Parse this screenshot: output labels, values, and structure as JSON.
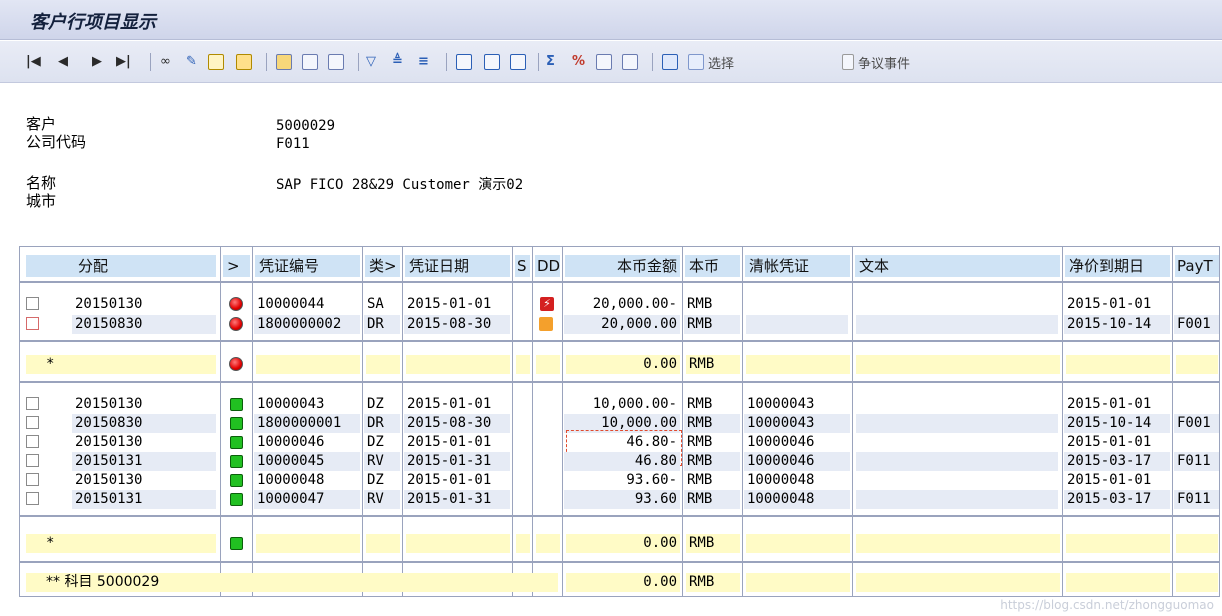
{
  "window": {
    "title": "客户行项目显示"
  },
  "toolbar": {
    "select_label": "选择",
    "dispute_label": "争议事件",
    "icons": [
      "first-page-icon",
      "prev-page-icon",
      "next-page-icon",
      "last-page-icon",
      "glasses-icon",
      "pencil-icon",
      "grid-icon",
      "doc-icon",
      "exchange-icon",
      "copy-icon",
      "find-icon",
      "filter-icon",
      "sort-asc-icon",
      "sort-desc-icon",
      "layout-icon",
      "layout2-icon",
      "layout3-icon",
      "sum-icon",
      "subtotal-icon",
      "export-icon",
      "print-icon",
      "info-icon",
      "info2-icon",
      "page-icon"
    ]
  },
  "header": {
    "customer_label": "客户",
    "customer_value": "5000029",
    "company_label": "公司代码",
    "company_value": "F011",
    "name_label": "名称",
    "name_value": "SAP FICO 28&29 Customer 演示02",
    "city_label": "城市",
    "city_value": ""
  },
  "columns": {
    "assignment": "分配",
    "status": ">",
    "doc_no": "凭证编号",
    "type": "类>",
    "doc_date": "凭证日期",
    "s": "S",
    "dd": "DD",
    "amount": "本币金额",
    "currency": "本币",
    "clearing": "清帐凭证",
    "text": "文本",
    "due_date": "净价到期日",
    "payt": "PayT"
  },
  "group1": {
    "rows": [
      {
        "assignment": "20150130",
        "doc_no": "10000044",
        "type": "SA",
        "doc_date": "2015-01-01",
        "amount": "20,000.00-",
        "currency": "RMB",
        "clearing": "",
        "text": "",
        "due_date": "2015-01-01",
        "payt": "",
        "status": "red",
        "dd": "lightning"
      },
      {
        "assignment": "20150830",
        "doc_no": "1800000002",
        "type": "DR",
        "doc_date": "2015-08-30",
        "amount": "20,000.00",
        "currency": "RMB",
        "clearing": "",
        "text": "",
        "due_date": "2015-10-14",
        "payt": "F001",
        "status": "red",
        "dd": "overdue"
      }
    ],
    "subtotal": {
      "marker": "*",
      "amount": "0.00",
      "currency": "RMB"
    }
  },
  "group2": {
    "rows": [
      {
        "assignment": "20150130",
        "doc_no": "10000043",
        "type": "DZ",
        "doc_date": "2015-01-01",
        "amount": "10,000.00-",
        "currency": "RMB",
        "clearing": "10000043",
        "text": "",
        "due_date": "2015-01-01",
        "payt": ""
      },
      {
        "assignment": "20150830",
        "doc_no": "1800000001",
        "type": "DR",
        "doc_date": "2015-08-30",
        "amount": "10,000.00",
        "currency": "RMB",
        "clearing": "10000043",
        "text": "",
        "due_date": "2015-10-14",
        "payt": "F001"
      },
      {
        "assignment": "20150130",
        "doc_no": "10000046",
        "type": "DZ",
        "doc_date": "2015-01-01",
        "amount": "46.80-",
        "currency": "RMB",
        "clearing": "10000046",
        "text": "",
        "due_date": "2015-01-01",
        "payt": ""
      },
      {
        "assignment": "20150131",
        "doc_no": "10000045",
        "type": "RV",
        "doc_date": "2015-01-31",
        "amount": "46.80",
        "currency": "RMB",
        "clearing": "10000046",
        "text": "",
        "due_date": "2015-03-17",
        "payt": "F011"
      },
      {
        "assignment": "20150130",
        "doc_no": "10000048",
        "type": "DZ",
        "doc_date": "2015-01-01",
        "amount": "93.60-",
        "currency": "RMB",
        "clearing": "10000048",
        "text": "",
        "due_date": "2015-01-01",
        "payt": ""
      },
      {
        "assignment": "20150131",
        "doc_no": "10000047",
        "type": "RV",
        "doc_date": "2015-01-31",
        "amount": "93.60",
        "currency": "RMB",
        "clearing": "10000048",
        "text": "",
        "due_date": "2015-03-17",
        "payt": "F011"
      }
    ],
    "subtotal": {
      "marker": "*",
      "amount": "0.00",
      "currency": "RMB"
    }
  },
  "total": {
    "label": "** 科目 5000029",
    "amount": "0.00",
    "currency": "RMB"
  },
  "colors": {
    "status_red": "#e10000",
    "status_green": "#21c021",
    "header_bg": "#cfe3f5",
    "subtotal_bg": "#fffbc6"
  },
  "watermark": "https://blog.csdn.net/zhongguomao"
}
